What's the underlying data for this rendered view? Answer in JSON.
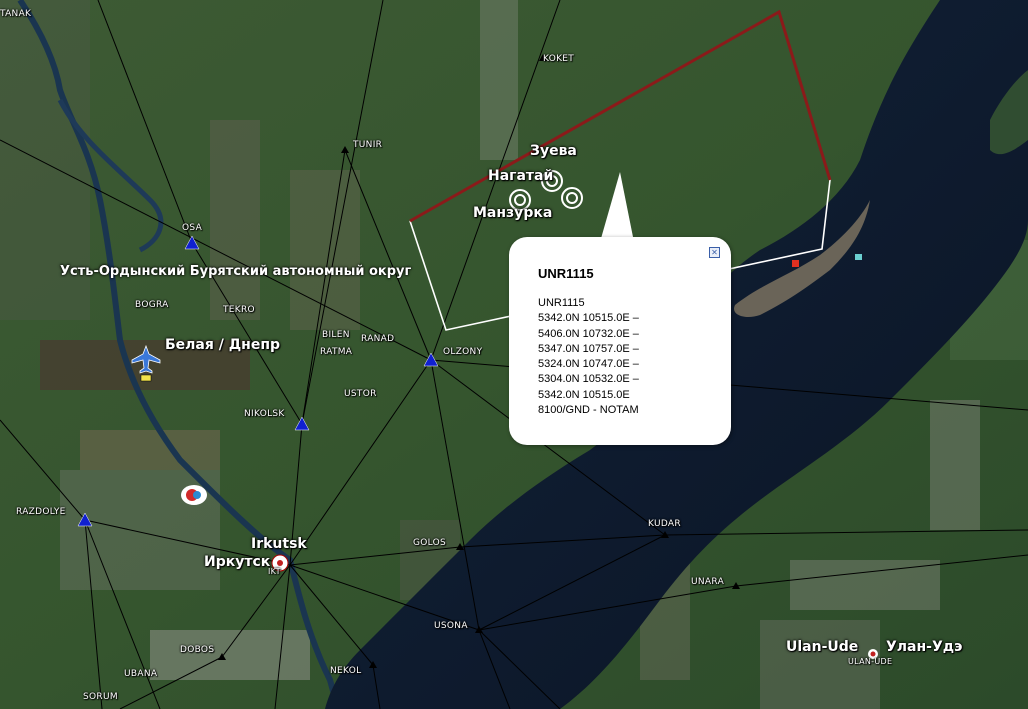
{
  "map": {
    "region_label": "Усть-Ордынский Бурятский автономный округ",
    "towns": {
      "zueva": "Зуева",
      "nagatai": "Нагатай",
      "manzurka": "Манзурка",
      "belaya": "Белая / Днепр",
      "irkutsk_en": "Irkutsk",
      "irkutsk_ru": "Иркутск",
      "irkutsk_code": "IKT",
      "ulanude_en": "Ulan-Ude",
      "ulanude_ru": "Улан-Удэ",
      "ulanude_code": "ULAN-UDE"
    },
    "fixes": {
      "anak": "TANAK",
      "koket": "KOKET",
      "tunir": "TUNIR",
      "osa": "OSA",
      "bogra": "BOGRA",
      "tekro": "TEKRO",
      "bilen": "BILEN",
      "ranad": "RANAD",
      "ratma": "RATMA",
      "olzony": "OLZONY",
      "ustor": "USTOR",
      "nikolsk": "NIKOLSK",
      "razdolye": "RAZDOLYE",
      "golos": "GOLOS",
      "kudar": "KUDAR",
      "unara": "UNARA",
      "usona": "USONA",
      "dobos": "DOBOS",
      "ubana": "UBANA",
      "nekol": "NEKOL",
      "sorum": "SORUM"
    },
    "colors": {
      "zone_outline": "#ffffff",
      "zone_red_edge": "#8b1a1a",
      "lake": "#0d1a2e",
      "airway": "#000000",
      "vor_marker": "#1020d0"
    }
  },
  "balloon": {
    "title": "UNR1115",
    "lines": [
      "UNR1115",
      "5342.0N 10515.0E –",
      "5406.0N 10732.0E –",
      "5347.0N 10757.0E –",
      "5324.0N 10747.0E –",
      "5304.0N 10532.0E –",
      "5342.0N 10515.0E",
      "8100/GND - NOTAM"
    ],
    "close_icon": "close-icon"
  }
}
